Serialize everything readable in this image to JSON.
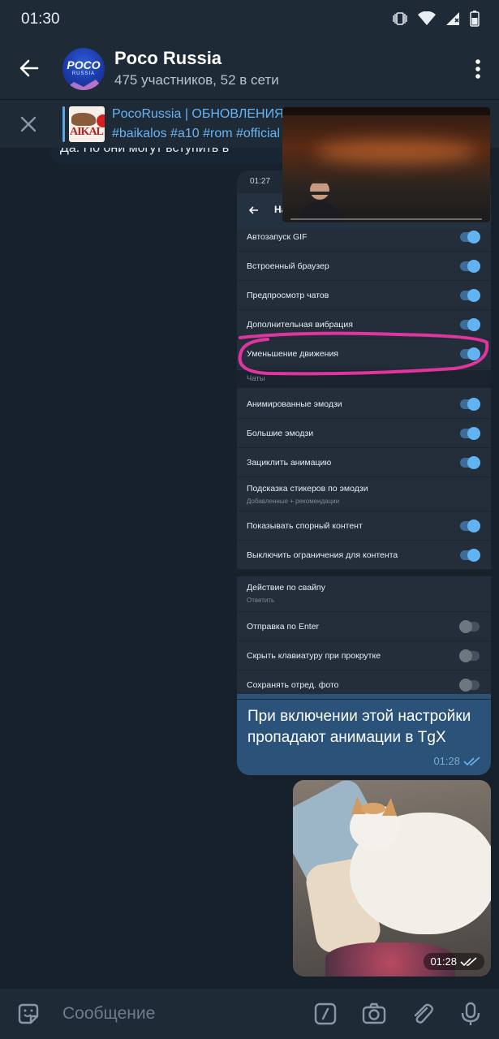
{
  "status": {
    "time": "01:30"
  },
  "header": {
    "title": "Poco Russia",
    "subtitle": "475 участников, 52 в сети",
    "avatar_text": "POCO",
    "avatar_subtext": "RUSSIA"
  },
  "pinned": {
    "title": "PocoRussia | ОБНОВЛЕНИЯ",
    "text": "#baikalos #a10 #rom #official",
    "thumb_text": "AIKAL"
  },
  "previous_message": {
    "text": "Да. Но  они могут вступить в"
  },
  "screenshot": {
    "time": "01:27",
    "header": "На",
    "rows_top": [
      {
        "label": "Автозапуск GIF",
        "on": true
      },
      {
        "label": "Встроенный браузер",
        "on": true
      },
      {
        "label": "Предпросмотр чатов",
        "on": true
      },
      {
        "label": "Дополнительная вибрация",
        "on": true
      },
      {
        "label": "Уменьшение движения",
        "on": true
      }
    ],
    "section": "Чаты",
    "rows_chats": [
      {
        "label": "Анимированные эмодзи",
        "on": true
      },
      {
        "label": "Большие эмодзи",
        "on": true
      },
      {
        "label": "Зациклить анимацию",
        "on": true
      },
      {
        "label": "Подсказка стикеров по эмодзи",
        "sub": "Добавленные + рекомендации"
      },
      {
        "label": "Показывать спорный контент",
        "on": true
      },
      {
        "label": "Выключить ограничения для контента",
        "on": true
      }
    ],
    "rows_bottom": [
      {
        "label": "Действие по свайпу",
        "sub": "Ответить"
      },
      {
        "label": "Отправка по Enter",
        "on": false
      },
      {
        "label": "Скрыть клавиатуру при прокрутке",
        "on": false
      },
      {
        "label": "Сохранять отред. фото",
        "on": false
      }
    ]
  },
  "message": {
    "text": "При включении этой настройки пропадают анимации в TgX",
    "time": "01:28"
  },
  "photo_message": {
    "time": "01:28"
  },
  "composer": {
    "placeholder": "Сообщение"
  },
  "colors": {
    "bg": "#17212b",
    "bar": "#1e2a36",
    "bubble_out": "#2b5278",
    "accent": "#6ab3f3",
    "annotation": "#e0359f"
  }
}
